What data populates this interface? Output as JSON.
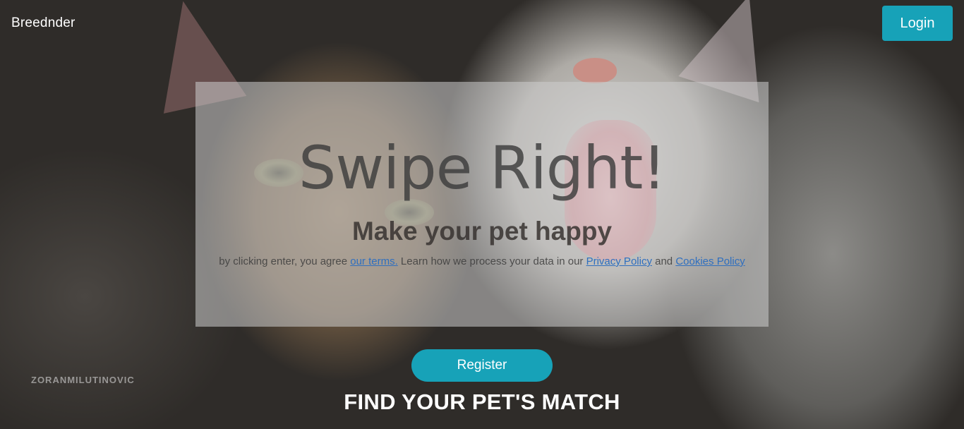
{
  "nav": {
    "brand": "Breednder",
    "login_label": "Login"
  },
  "hero": {
    "title": "Swipe Right!",
    "subtitle": "Make your pet happy",
    "terms_prefix": "by clicking enter, you agree ",
    "terms_link": "our terms.",
    "terms_middle": " Learn how we process your data in our ",
    "privacy_link": "Privacy Policy",
    "terms_and": " and ",
    "cookies_link": "Cookies Policy"
  },
  "cta": {
    "register_label": "Register",
    "tagline": "FIND YOUR PET'S MATCH"
  },
  "background": {
    "watermark": "ZORANMILUTINOVIC"
  },
  "colors": {
    "accent": "#17a2b8",
    "link": "#2f6fbf"
  }
}
